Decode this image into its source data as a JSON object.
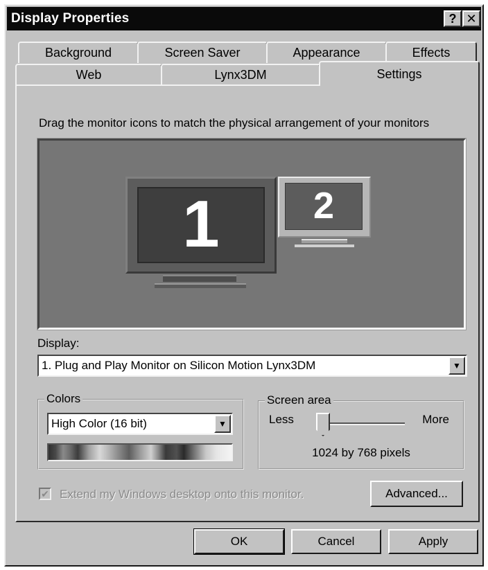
{
  "window": {
    "title": "Display Properties",
    "help_label": "?",
    "close_label": "✕"
  },
  "tabs": {
    "row1": [
      "Background",
      "Screen Saver",
      "Appearance",
      "Effects"
    ],
    "row2": [
      "Web",
      "Lynx3DM",
      "Settings"
    ],
    "active": "Settings"
  },
  "settings": {
    "instruction": "Drag the monitor icons to match the physical arrangement of your monitors",
    "monitors": [
      {
        "number": "1"
      },
      {
        "number": "2"
      }
    ],
    "display_label": "Display:",
    "display_value": "1. Plug and Play Monitor on Silicon Motion Lynx3DM",
    "colors": {
      "title": "Colors",
      "value": "High Color (16 bit)"
    },
    "screen_area": {
      "title": "Screen area",
      "less_label": "Less",
      "more_label": "More",
      "resolution_text": "1024 by 768 pixels",
      "slider_position": 0
    },
    "extend_checkbox": {
      "label": "Extend my Windows desktop onto this monitor.",
      "checked": true,
      "enabled": false,
      "mark": "✔"
    },
    "advanced_label": "Advanced..."
  },
  "buttons": {
    "ok": "OK",
    "cancel": "Cancel",
    "apply": "Apply"
  },
  "icons": {
    "dropdown_arrow": "▼"
  }
}
